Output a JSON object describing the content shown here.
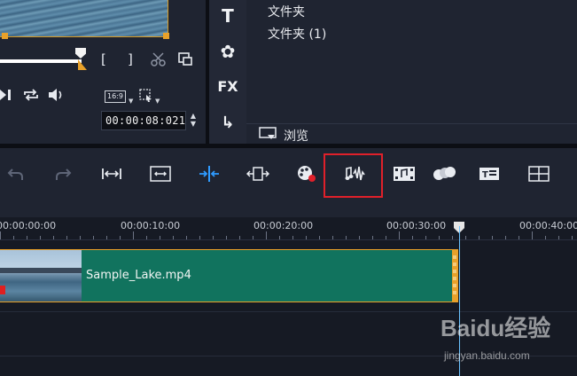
{
  "player": {
    "mark_in_label": "[",
    "mark_out_label": "]",
    "aspect_ratio": "16:9",
    "timecode": "00:00:08:021",
    "scrub_progress": 0.4
  },
  "library": {
    "rail_icons": [
      {
        "name": "title-icon",
        "glyph": "T"
      },
      {
        "name": "transition-icon",
        "glyph": "✿"
      },
      {
        "name": "filter-icon",
        "glyph": "FX"
      },
      {
        "name": "path-icon",
        "glyph": "↳"
      }
    ],
    "folders": [
      "文件夹",
      "文件夹 (1)"
    ],
    "browse_label": "浏览"
  },
  "toolbar": {
    "tools": [
      "undo-icon",
      "redo-icon",
      "fit-project-icon",
      "resize-window-icon",
      "split-icon",
      "ripple-edit-icon",
      "color-grading-icon",
      "sound-mixer-icon",
      "auto-music-icon",
      "motion-tracking-icon",
      "subtitle-editor-icon",
      "multi-camera-icon"
    ],
    "highlighted_tool": "sound-mixer-icon",
    "highlight_color": "#e0202a"
  },
  "timeline": {
    "ruler_labels": [
      "00:00:00:00",
      "00:00:10:00",
      "00:00:20:00",
      "00:00:30:00",
      "00:00:40:00"
    ],
    "clip": {
      "name": "Sample_Lake.mp4",
      "color": "#11735e",
      "border_color": "#e8a12a"
    },
    "playhead_color": "#6cc3ff"
  },
  "watermark": {
    "text": "Baidu经验",
    "url": "jingyan.baidu.com"
  }
}
